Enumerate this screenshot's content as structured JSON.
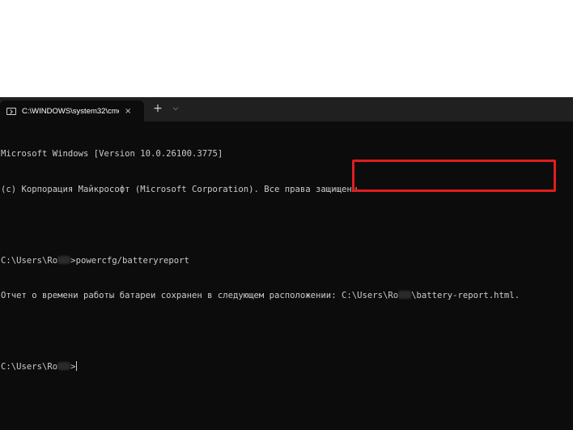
{
  "tab": {
    "title": "C:\\WINDOWS\\system32\\cmd.e",
    "close_glyph": "×",
    "new_tab_glyph": "+",
    "dropdown_glyph": "⌵"
  },
  "console": {
    "line1": "Microsoft Windows [Version 10.0.26100.3775]",
    "line2": "(c) Корпорация Майкрософт (Microsoft Corporation). Все права защищены.",
    "prompt1_prefix": "C:\\Users\\Ro",
    "prompt1_suffix": ">",
    "command": "powercfg/batteryreport",
    "report_msg": "Отчет о времени работы батареи сохранен в следующем расположении: ",
    "report_path_prefix": "C:\\Users\\Ro",
    "report_path_suffix": "\\battery-report.html.",
    "prompt2_prefix": "C:\\Users\\Ro",
    "prompt2_suffix": ">"
  },
  "colors": {
    "terminal_bg": "#0c0c0c",
    "tabbar_bg": "#202020",
    "text": "#cccccc",
    "highlight_border": "#e11d1d"
  }
}
